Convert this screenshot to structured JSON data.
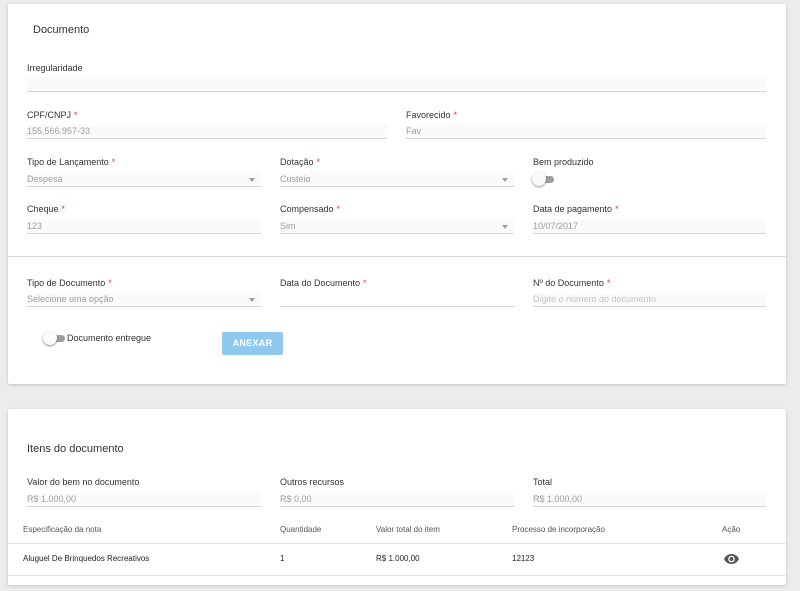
{
  "document_card": {
    "title": "Documento",
    "irregularidade": {
      "label": "Irregularidade",
      "value": ""
    },
    "cpf_cnpj": {
      "label": "CPF/CNPJ",
      "required": "*",
      "value": "155.566.957-33"
    },
    "favorecido": {
      "label": "Favorecido",
      "required": "*",
      "value": "Fav"
    },
    "tipo_lancamento": {
      "label": "Tipo de Lançamento",
      "required": "*",
      "value": "Despesa"
    },
    "dotacao": {
      "label": "Dotação",
      "required": "*",
      "value": "Custeio"
    },
    "bem_produzido": {
      "label": "Bem produzido",
      "on": false
    },
    "cheque": {
      "label": "Cheque",
      "required": "*",
      "value": "123"
    },
    "compensado": {
      "label": "Compensado",
      "required": "*",
      "value": "Sim"
    },
    "data_pagamento": {
      "label": "Data de pagamento",
      "required": "*",
      "value": "10/07/2017"
    },
    "tipo_documento": {
      "label": "Tipo de Documento",
      "required": "*",
      "placeholder": "Selecione uma opção"
    },
    "data_documento": {
      "label": "Data do Documento",
      "required": "*",
      "value": ""
    },
    "numero_documento": {
      "label": "Nº do Documento",
      "required": "*",
      "placeholder": "Digite o número do documento"
    },
    "documento_entregue": {
      "label": "Documento entregue",
      "on": false
    },
    "anexar_button": "ANEXAR"
  },
  "items_card": {
    "title": "Itens do documento",
    "valor_bem": {
      "label": "Valor do bem no documento",
      "value": "R$ 1.000,00"
    },
    "outros_recursos": {
      "label": "Outros recursos",
      "value": "R$ 0,00"
    },
    "total": {
      "label": "Total",
      "value": "R$ 1.000,00"
    },
    "table": {
      "headers": [
        "Especificação da nota",
        "Quantidade",
        "Valor total do item",
        "Processo de incorporação",
        "Ação"
      ],
      "rows": [
        {
          "especificacao": "Aluguel De Brinquedos Recreativos",
          "quantidade": "1",
          "valor": "R$ 1.000,00",
          "processo": "12123",
          "acao_icon": "eye-icon"
        }
      ]
    }
  },
  "colors": {
    "accent_button": "#8fc9f0",
    "required": "#e53935",
    "background": "#ececec"
  }
}
